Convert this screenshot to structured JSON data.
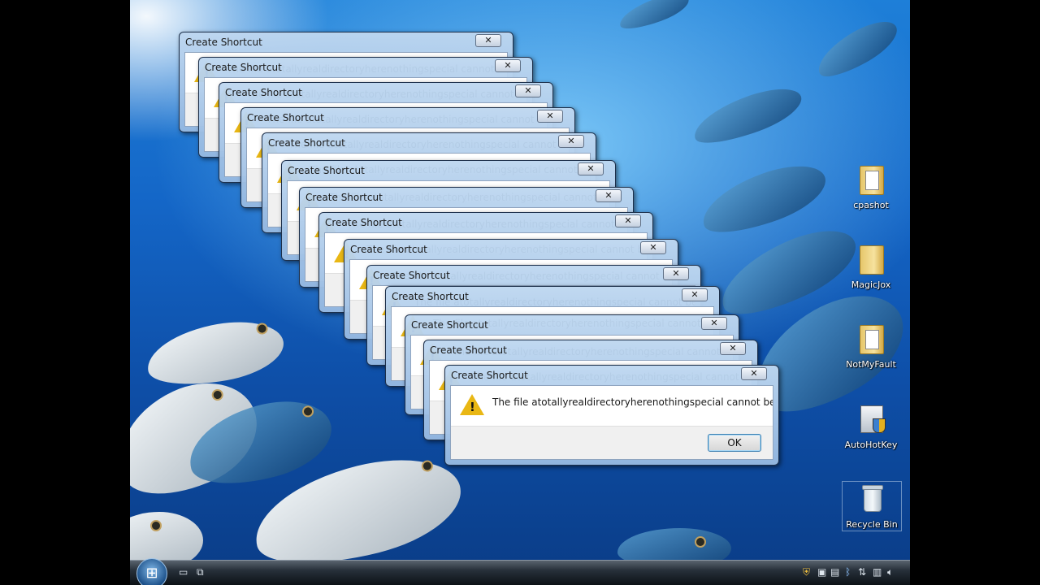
{
  "dialog": {
    "title": "Create Shortcut",
    "message": "The file atotallyrealdirectoryherenothingspecial cannot be found.",
    "ok_label": "OK",
    "close_glyph": "✕",
    "warning_glyph": "!"
  },
  "desktop_icons": [
    {
      "label": "cpashot",
      "icon": "folder-icon"
    },
    {
      "label": "MagicJox",
      "icon": "folder-icon"
    },
    {
      "label": "NotMyFault",
      "icon": "folder-icon"
    },
    {
      "label": "AutoHotKey",
      "icon": "installer-icon"
    },
    {
      "label": "Recycle Bin",
      "icon": "recycle-bin-icon"
    }
  ],
  "taskbar": {
    "start_glyph": "⊞",
    "quicklaunch": [
      {
        "name": "show-desktop-icon",
        "glyph": "▭"
      },
      {
        "name": "switch-windows-icon",
        "glyph": "⧉"
      }
    ],
    "tray": [
      {
        "name": "shield-icon",
        "glyph": "⛨"
      },
      {
        "name": "tray-app-icon",
        "glyph": "▣"
      },
      {
        "name": "tray-app2-icon",
        "glyph": "▤"
      },
      {
        "name": "bluetooth-icon",
        "glyph": "ᛒ"
      },
      {
        "name": "network-icon",
        "glyph": "⇅"
      },
      {
        "name": "display-icon",
        "glyph": "▥"
      },
      {
        "name": "volume-icon",
        "glyph": "🔈︎"
      }
    ]
  }
}
